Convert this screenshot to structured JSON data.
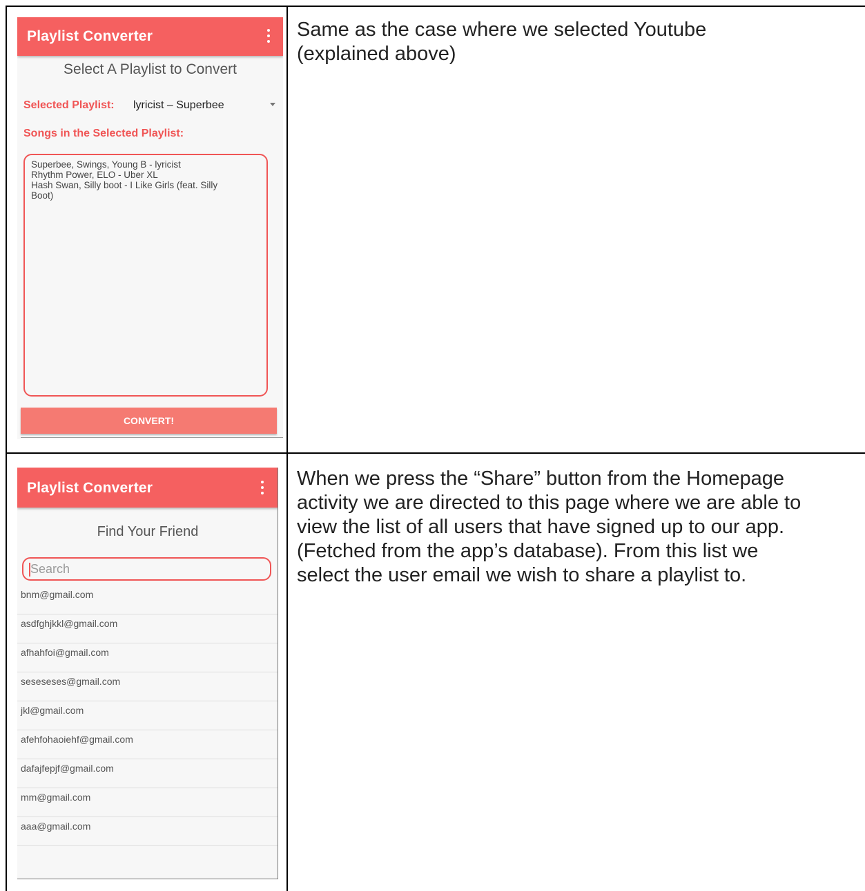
{
  "cell1": {
    "screen": {
      "app_title": "Playlist Converter",
      "menu_icon": "overflow-menu-icon",
      "heading": "Select A Playlist to Convert",
      "selected_label": "Selected Playlist:",
      "selected_value": "lyricist – Superbee",
      "songs_label": "Songs in the Selected Playlist:",
      "songs": [
        "Superbee, Swings, Young B - lyricist",
        "Rhythm Power, ELO - Uber XL",
        "Hash Swan, Silly boot - I Like Girls (feat. Silly",
        "Boot)"
      ],
      "convert_label": "CONVERT!"
    },
    "description": [
      "Same as the case where we selected Youtube",
      "(explained above)"
    ]
  },
  "cell2": {
    "screen": {
      "app_title": "Playlist Converter",
      "menu_icon": "overflow-menu-icon",
      "heading": "Find Your Friend",
      "search_placeholder": "Search",
      "users": [
        "bnm@gmail.com",
        "asdfghjkkl@gmail.com",
        "afhahfoi@gmail.com",
        "seseseses@gmail.com",
        "jkl@gmail.com",
        "afehfohaoiehf@gmail.com",
        "dafajfepjf@gmail.com",
        "mm@gmail.com",
        "aaa@gmail.com"
      ]
    },
    "description": [
      "When we press the “Share” button from the Homepage",
      "activity we are directed to this page where we are able to",
      "view the list of all users that have signed up to our app.",
      "(Fetched from the app’s database). From this list we",
      "select the user email we wish to share a playlist to."
    ]
  },
  "colors": {
    "accent": "#f56060",
    "button": "#f57a72"
  }
}
